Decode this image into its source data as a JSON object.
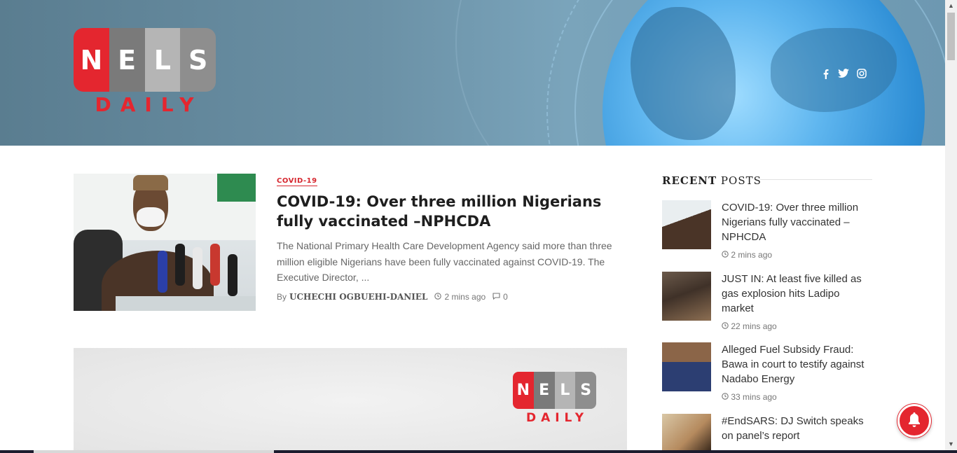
{
  "header": {
    "logo": {
      "letters": [
        "N",
        "E",
        "L",
        "S"
      ],
      "subtitle": "DAILY"
    },
    "social_icons": [
      "facebook-icon",
      "twitter-icon",
      "instagram-icon"
    ],
    "colors": {
      "brand_red": "#e4262f",
      "header_bg": "#6b91a6"
    }
  },
  "featured": {
    "category": "COVID-19",
    "title": "COVID-19: Over three million Nigerians fully vaccinated –NPHCDA",
    "excerpt": "The National Primary Health Care Development Agency said more than three million eligible Nigerians have been fully vaccinated against COVID-19. The Executive Director, ...",
    "by": "By",
    "author": "UCHECHI OGBUEHI-DANIEL",
    "time": "2 mins ago",
    "comments": "0"
  },
  "banner": {
    "logo": {
      "letters": [
        "N",
        "E",
        "L",
        "S"
      ],
      "subtitle": "DAILY"
    }
  },
  "sidebar": {
    "title_bold": "RECENT",
    "title_rest": " POSTS",
    "posts": [
      {
        "title": "COVID-19: Over three million Nigerians fully vaccinated –NPHCDA",
        "time": "2 mins ago"
      },
      {
        "title": "JUST IN: At least five killed as gas explosion hits Ladipo market",
        "time": "22 mins ago"
      },
      {
        "title": "Alleged Fuel Subsidy Fraud: Bawa in court to testify against Nadabo Energy",
        "time": "33 mins ago"
      },
      {
        "title": "#EndSARS: DJ Switch speaks on panel’s report",
        "time": ""
      }
    ]
  }
}
